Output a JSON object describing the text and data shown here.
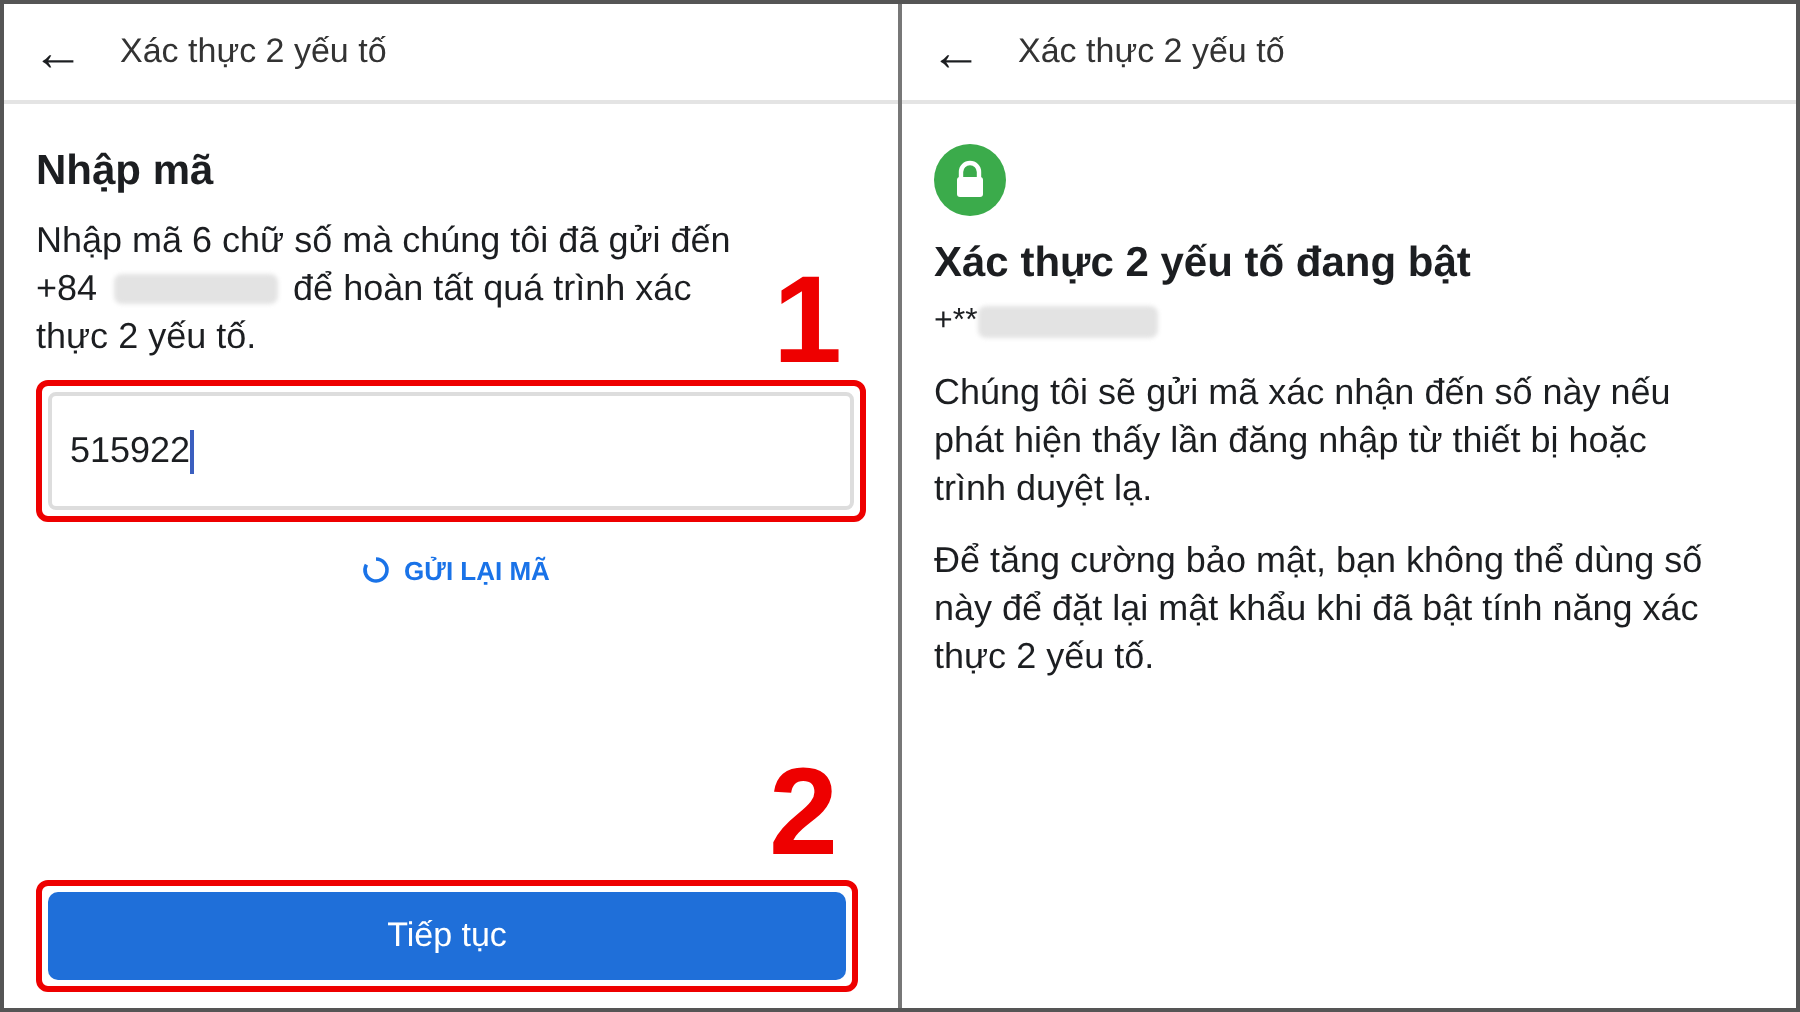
{
  "left_screen": {
    "header": {
      "back": "←",
      "title": "Xác thực 2 yếu tố"
    },
    "heading": "Nhập mã",
    "instruction_lines": [
      "Nhập mã 6 chữ số mà chúng tôi đã gửi đến",
      "+84",
      "để hoàn tất quá trình xác",
      "thực 2 yếu tố."
    ],
    "code_field": {
      "value": "515922"
    },
    "resend_link": "GỬI LẠI MÃ",
    "continue_button": "Tiếp tục",
    "step_markers": [
      "1",
      "2"
    ]
  },
  "right_screen": {
    "header": {
      "back": "←",
      "title": "Xác thực 2 yếu tố"
    },
    "heading": "Xác thực 2 yếu tố đang bật",
    "phone_prefix": "+**",
    "paragraphs": [
      {
        "text": "Chúng tôi sẽ gửi mã xác nhận đến số này nếu phát hiện thấy lần đăng nhập từ thiết bị hoặc trình duyệt lạ."
      },
      {
        "text": "Để tăng cường bảo mật, bạn không thể dùng số này để đặt lại mật khẩu khi đã bật tính năng xác thực 2 yếu tố."
      }
    ]
  }
}
